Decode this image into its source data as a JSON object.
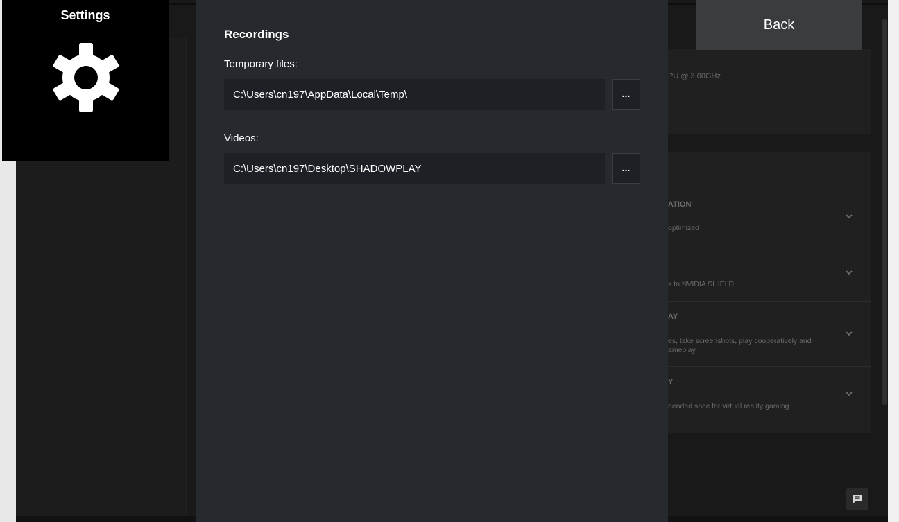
{
  "tile": {
    "title": "Settings",
    "icon": "gear-icon"
  },
  "back_button": {
    "label": "Back"
  },
  "dialog": {
    "title": "Recordings",
    "temp": {
      "label": "Temporary files:",
      "value": "C:\\Users\\cn197\\AppData\\Local\\Temp\\",
      "browse_label": "..."
    },
    "videos": {
      "label": "Videos:",
      "value": "C:\\Users\\cn197\\Desktop\\SHADOWPLAY",
      "browse_label": "..."
    }
  },
  "background": {
    "system_info": "PU @ 3.00GHz",
    "features": [
      {
        "title": "ATION",
        "desc": "optimized"
      },
      {
        "title": "",
        "desc": "s to NVIDIA SHIELD"
      },
      {
        "title": "AY",
        "desc": "es, take screenshots, play cooperatively and\nameplay."
      },
      {
        "title": "Y",
        "desc": "nended spec for virtual reality gaming"
      }
    ],
    "chat_icon": "chat-icon"
  },
  "colors": {
    "dialog_bg": "#262a2e",
    "field_bg": "#1d2024",
    "tile_bg": "#000000",
    "back_bg": "#3a3c3e"
  }
}
